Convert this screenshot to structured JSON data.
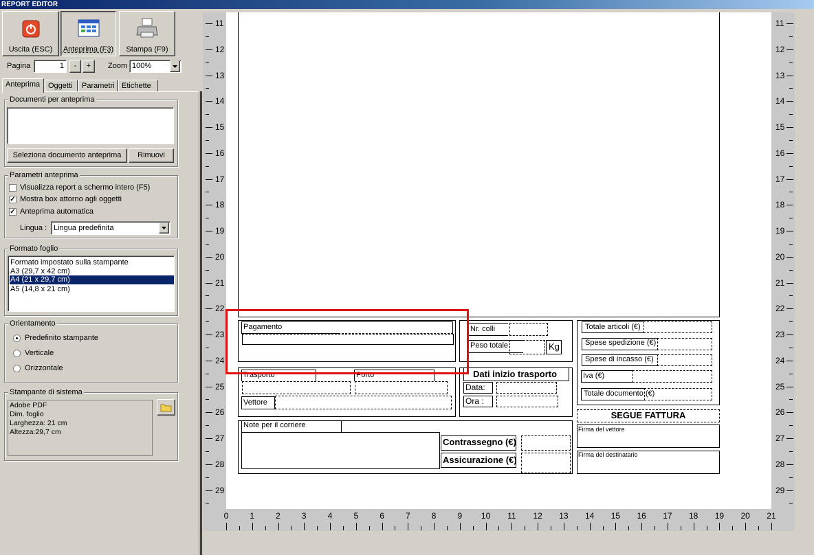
{
  "window": {
    "title": "REPORT EDITOR"
  },
  "toolbar": {
    "exit_label": "Uscita (ESC)",
    "preview_label": "Anteprima (F3)",
    "print_label": "Stampa (F9)"
  },
  "page_nav": {
    "label": "Pagina",
    "value": "1",
    "minus": "-",
    "plus": "+"
  },
  "zoom": {
    "label": "Zoom",
    "value": "100%"
  },
  "tabs": [
    "Anteprima",
    "Oggetti",
    "Parametri",
    "Etichette"
  ],
  "documents": {
    "title": "Documenti per anteprima",
    "select_button": "Seleziona documento anteprima",
    "remove_button": "Rimuovi"
  },
  "preview_params": {
    "title": "Parametri anteprima",
    "options": [
      {
        "label": "Visualizza report a schermo intero (F5)",
        "checked": false
      },
      {
        "label": "Mostra box attorno agli oggetti",
        "checked": true
      },
      {
        "label": "Anteprima automatica",
        "checked": true
      }
    ],
    "language_label": "Lingua :",
    "language_value": "Lingua predefinita"
  },
  "paper_format": {
    "title": "Formato foglio",
    "options": [
      "Formato impostato sulla stampante",
      "A3 (29,7 x 42 cm)",
      "A4 (21 x 29,7 cm)",
      "A5 (14,8 x 21 cm)"
    ],
    "selected": "A4 (21 x 29,7 cm)"
  },
  "orientation": {
    "title": "Orientamento",
    "options": [
      "Predefinito stampante",
      "Verticale",
      "Orizzontale"
    ],
    "selected": "Predefinito stampante"
  },
  "printer": {
    "title": "Stampante di sistema",
    "lines": [
      "Adobe PDF",
      "Dim. foglio",
      "Larghezza: 21 cm",
      "Altezza:29,7 cm"
    ]
  },
  "ruler": {
    "vertical": [
      "11",
      "12",
      "13",
      "14",
      "15",
      "16",
      "17",
      "18",
      "19",
      "20",
      "21",
      "22",
      "23",
      "24",
      "25",
      "26",
      "27",
      "28",
      "29"
    ],
    "horizontal": [
      "0",
      "1",
      "2",
      "3",
      "4",
      "5",
      "6",
      "7",
      "8",
      "9",
      "10",
      "11",
      "12",
      "13",
      "14",
      "15",
      "16",
      "17",
      "18",
      "19",
      "20",
      "21"
    ]
  },
  "report": {
    "pagamento": "Pagamento",
    "trasporto": "Trasporto",
    "porto": "Porto",
    "vettore": "Vettore",
    "note_corriere": "Note per il corriere",
    "nr_colli": "Nr. colli",
    "peso_totale": "Peso totale",
    "kg": "Kg",
    "dati_inizio": "Dati inizio trasporto",
    "data": "Data:",
    "ora": "Ora :",
    "contrassegno": "Contrassegno (€)",
    "assicurazione": "Assicurazione (€)",
    "totale_articoli": "Totale articoli (€)",
    "spese_spedizione": "Spese spedizione (€)",
    "spese_incasso": "Spese di incasso (€)",
    "iva": "Iva (€)",
    "totale_documento": "Totale documento (€)",
    "segue_fattura": "SEGUE FATTURA",
    "firma_vettore": "Firma del vettore",
    "firma_destinatario": "Firma del destinatario"
  },
  "highlight_color": "#e01010"
}
